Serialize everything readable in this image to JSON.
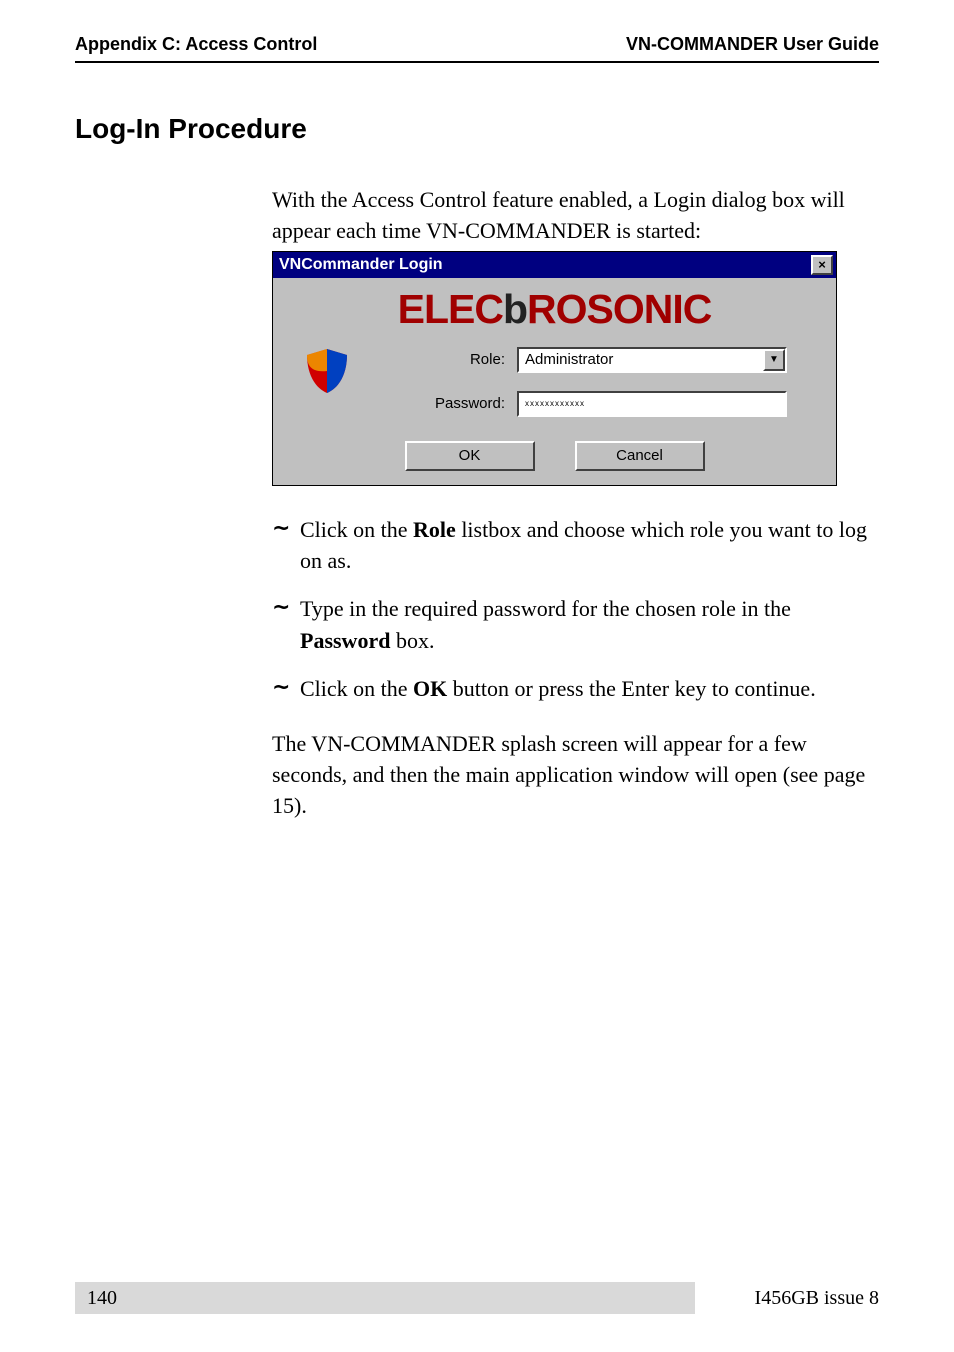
{
  "header": {
    "left": "Appendix C: Access Control",
    "right": "VN-COMMANDER User Guide"
  },
  "heading": "Log-In Procedure",
  "intro": "With the Access Control feature enabled, a Login dialog box will appear each time VN-COMMANDER is started:",
  "dialog": {
    "title": "VNCommander Login",
    "close": "×",
    "logo_prefix": "ELEC",
    "logo_mid": "b",
    "logo_suffix": "ROSONIC",
    "role_label": "Role:",
    "role_value": "Administrator",
    "password_label": "Password:",
    "password_value": "хххххххххххх",
    "ok": "OK",
    "cancel": "Cancel"
  },
  "steps": [
    {
      "pre": "Click on the ",
      "bold": "Role",
      "post": " listbox and choose which role you want to log on as."
    },
    {
      "pre": "Type in the required password for the chosen role in the ",
      "bold": "Password",
      "post": " box."
    },
    {
      "pre": "Click on the ",
      "bold": "OK",
      "post": " button or press the Enter key to continue."
    }
  ],
  "outro": "The VN-COMMANDER splash screen will appear for a few seconds, and then the main application window will open (see page 15).",
  "footer": {
    "page": "140",
    "doc": "I456GB issue 8"
  },
  "bullet": "~"
}
